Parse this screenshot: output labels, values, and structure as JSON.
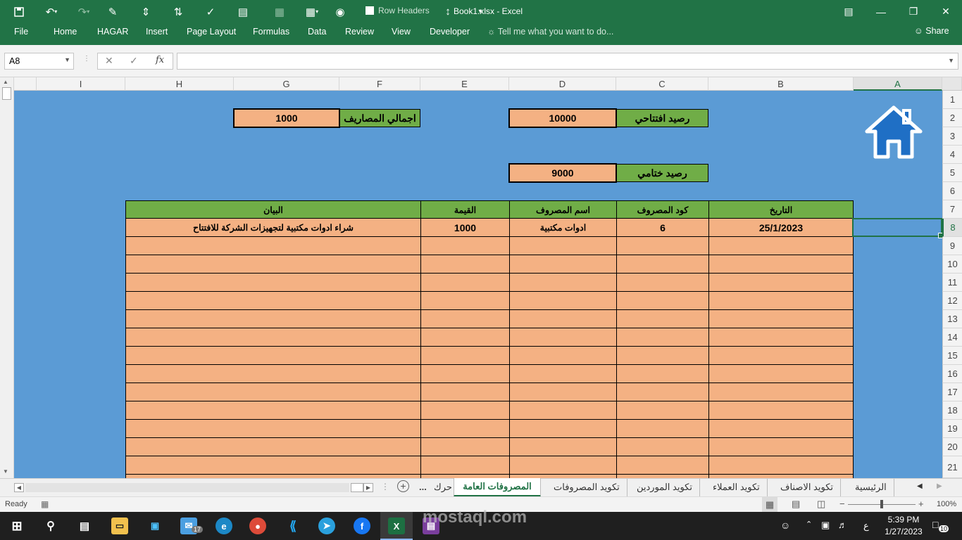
{
  "window": {
    "title": "Book1.xlsx - Excel",
    "row_headers_label": "Row Headers",
    "minimize": "—",
    "maximize": "❐",
    "close": "✕"
  },
  "ribbon": {
    "tabs": [
      "File",
      "Home",
      "HAGAR",
      "Insert",
      "Page Layout",
      "Formulas",
      "Data",
      "Review",
      "View",
      "Developer"
    ],
    "tell_me": "Tell me what you want to do...",
    "share": "Share"
  },
  "formula_bar": {
    "name_box": "A8",
    "fx": "fx",
    "value": ""
  },
  "grid": {
    "columns": [
      "I",
      "H",
      "G",
      "F",
      "E",
      "D",
      "C",
      "B",
      "A"
    ],
    "rows": [
      "1",
      "2",
      "4",
      "5",
      "6",
      "7",
      "8",
      "9",
      "10",
      "11",
      "12",
      "13",
      "14",
      "15",
      "16",
      "17",
      "18",
      "19",
      "20",
      "21"
    ],
    "row3": "3",
    "selected_cell": "A8"
  },
  "summary": {
    "total_expenses_label": "اجمالي المصاريف",
    "total_expenses_value": "1000",
    "opening_balance_label": "رصيد افتتاحي",
    "opening_balance_value": "10000",
    "closing_balance_label": "رصيد ختامي",
    "closing_balance_value": "9000"
  },
  "table": {
    "headers": {
      "description": "البيان",
      "amount": "القيمة",
      "expense_name": "اسم المصروف",
      "expense_code": "كود المصروف",
      "date": "التاريخ"
    },
    "rows": [
      {
        "description": "شراء ادوات مكتبية لتجهيزات الشركة للافتتاح",
        "amount": "1000",
        "expense_name": "ادوات مكتبية",
        "expense_code": "6",
        "date": "25/1/2023"
      }
    ]
  },
  "sheet_tabs": {
    "tabs": [
      "الرئيسية",
      "تكويد الاصناف",
      "تكويد العملاء",
      "تكويد الموردين",
      "تكويد المصروفات",
      "المصروفات العامة",
      "حرك"
    ],
    "active": "المصروفات العامة",
    "more": "..."
  },
  "status_bar": {
    "ready": "Ready",
    "zoom": "100%"
  },
  "taskbar": {
    "time": "5:39 PM",
    "date": "1/27/2023",
    "lang": "ع",
    "notifications": "10",
    "mail_badge": "17"
  },
  "watermark": "mostaql.com",
  "colors": {
    "excel_green": "#217346",
    "sheet_bg": "#5b9bd5",
    "header_green": "#70ad47",
    "cell_peach": "#f4b183"
  }
}
